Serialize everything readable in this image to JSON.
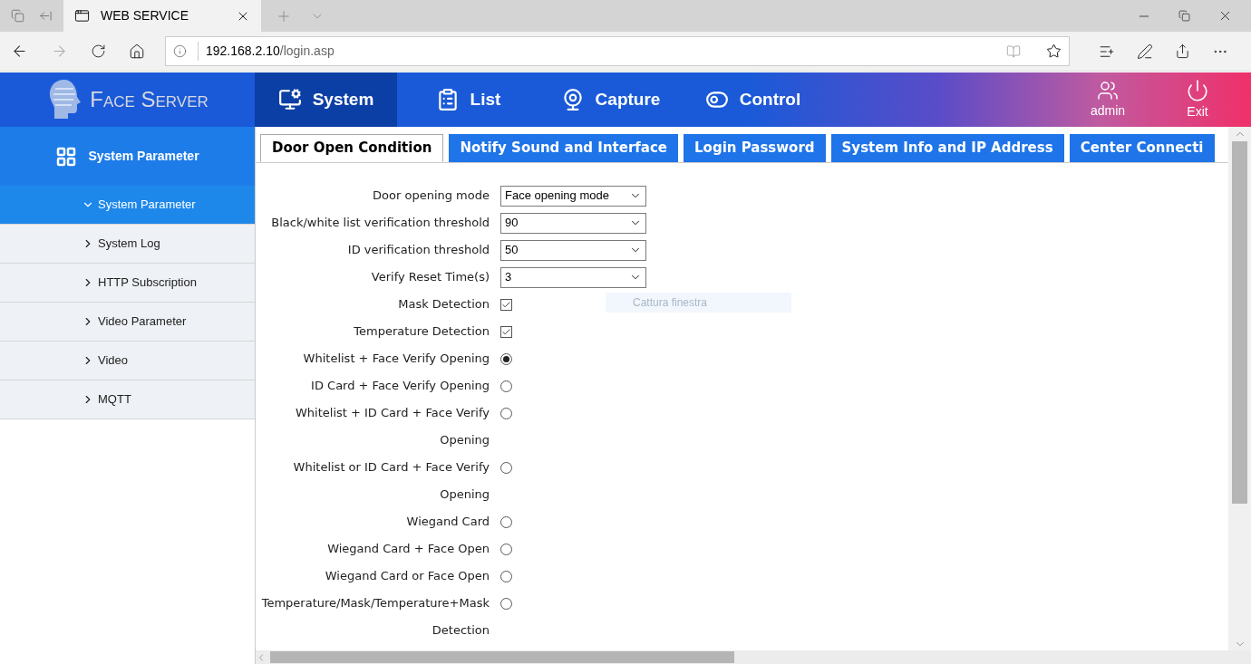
{
  "browser": {
    "tab_title": "WEB SERVICE",
    "url_host": "192.168.2.10",
    "url_path": "/login.asp"
  },
  "header": {
    "logo_text": "Face Server",
    "nav": [
      {
        "label": "System",
        "selected": true
      },
      {
        "label": "List",
        "selected": false
      },
      {
        "label": "Capture",
        "selected": false
      },
      {
        "label": "Control",
        "selected": false
      }
    ],
    "user": "admin",
    "exit": "Exit"
  },
  "sidebar": {
    "title": "System Parameter",
    "items": [
      {
        "label": "System Parameter",
        "selected": true,
        "expanded": true
      },
      {
        "label": "System Log",
        "selected": false,
        "expanded": false
      },
      {
        "label": "HTTP Subscription",
        "selected": false,
        "expanded": false
      },
      {
        "label": "Video Parameter",
        "selected": false,
        "expanded": false
      },
      {
        "label": "Video",
        "selected": false,
        "expanded": false
      },
      {
        "label": "MQTT",
        "selected": false,
        "expanded": false
      }
    ]
  },
  "tabs": [
    {
      "label": "Door Open Condition",
      "selected": true
    },
    {
      "label": "Notify Sound and Interface",
      "selected": false
    },
    {
      "label": "Login Password",
      "selected": false
    },
    {
      "label": "System Info and IP Address",
      "selected": false
    },
    {
      "label": "Center Connecti",
      "selected": false
    }
  ],
  "form": {
    "rows": [
      {
        "kind": "select",
        "label": "Door opening mode",
        "value": "Face opening mode"
      },
      {
        "kind": "select",
        "label": "Black/white list verification threshold",
        "value": "90"
      },
      {
        "kind": "select",
        "label": "ID verification threshold",
        "value": "50"
      },
      {
        "kind": "select",
        "label": "Verify Reset Time(s)",
        "value": "3"
      },
      {
        "kind": "checkbox",
        "label": "Mask Detection",
        "checked": true
      },
      {
        "kind": "checkbox",
        "label": "Temperature Detection",
        "checked": true
      },
      {
        "kind": "radio",
        "label": "Whitelist + Face Verify Opening",
        "selected": true
      },
      {
        "kind": "radio",
        "label": "ID Card + Face Verify Opening",
        "selected": false
      },
      {
        "kind": "radio",
        "label": "Whitelist + ID Card + Face Verify Opening",
        "selected": false
      },
      {
        "kind": "radio",
        "label": "Whitelist or ID Card + Face Verify Opening",
        "selected": false
      },
      {
        "kind": "radio",
        "label": "Wiegand Card",
        "selected": false
      },
      {
        "kind": "radio",
        "label": "Wiegand Card + Face Open",
        "selected": false
      },
      {
        "kind": "radio",
        "label": "Wiegand Card or Face Open",
        "selected": false
      },
      {
        "kind": "radio",
        "label": "Temperature/Mask/Temperature+Mask Detection",
        "selected": false
      }
    ]
  },
  "tooltip": "Cattura finestra"
}
